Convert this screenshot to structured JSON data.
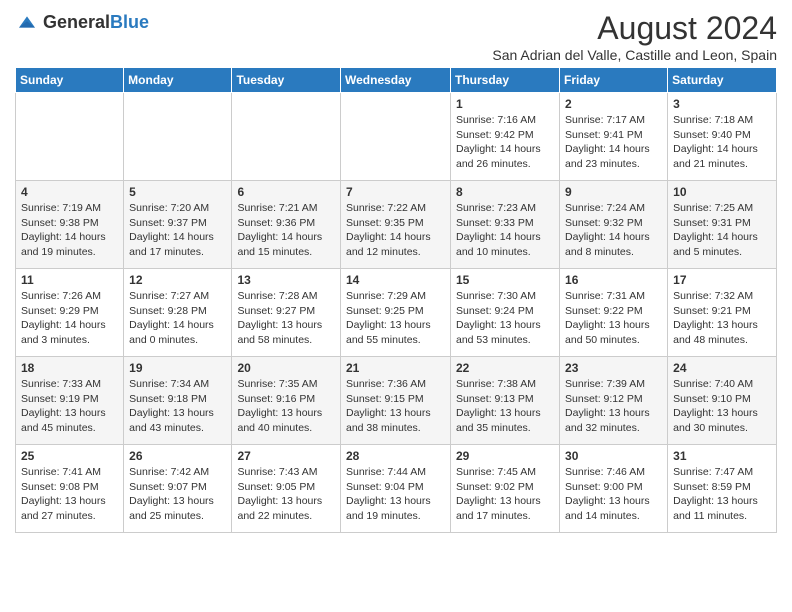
{
  "logo": {
    "text_general": "General",
    "text_blue": "Blue"
  },
  "title": {
    "month_year": "August 2024",
    "location": "San Adrian del Valle, Castille and Leon, Spain"
  },
  "weekdays": [
    "Sunday",
    "Monday",
    "Tuesday",
    "Wednesday",
    "Thursday",
    "Friday",
    "Saturday"
  ],
  "weeks": [
    [
      {
        "day": "",
        "info": ""
      },
      {
        "day": "",
        "info": ""
      },
      {
        "day": "",
        "info": ""
      },
      {
        "day": "",
        "info": ""
      },
      {
        "day": "1",
        "info": "Sunrise: 7:16 AM\nSunset: 9:42 PM\nDaylight: 14 hours and 26 minutes."
      },
      {
        "day": "2",
        "info": "Sunrise: 7:17 AM\nSunset: 9:41 PM\nDaylight: 14 hours and 23 minutes."
      },
      {
        "day": "3",
        "info": "Sunrise: 7:18 AM\nSunset: 9:40 PM\nDaylight: 14 hours and 21 minutes."
      }
    ],
    [
      {
        "day": "4",
        "info": "Sunrise: 7:19 AM\nSunset: 9:38 PM\nDaylight: 14 hours and 19 minutes."
      },
      {
        "day": "5",
        "info": "Sunrise: 7:20 AM\nSunset: 9:37 PM\nDaylight: 14 hours and 17 minutes."
      },
      {
        "day": "6",
        "info": "Sunrise: 7:21 AM\nSunset: 9:36 PM\nDaylight: 14 hours and 15 minutes."
      },
      {
        "day": "7",
        "info": "Sunrise: 7:22 AM\nSunset: 9:35 PM\nDaylight: 14 hours and 12 minutes."
      },
      {
        "day": "8",
        "info": "Sunrise: 7:23 AM\nSunset: 9:33 PM\nDaylight: 14 hours and 10 minutes."
      },
      {
        "day": "9",
        "info": "Sunrise: 7:24 AM\nSunset: 9:32 PM\nDaylight: 14 hours and 8 minutes."
      },
      {
        "day": "10",
        "info": "Sunrise: 7:25 AM\nSunset: 9:31 PM\nDaylight: 14 hours and 5 minutes."
      }
    ],
    [
      {
        "day": "11",
        "info": "Sunrise: 7:26 AM\nSunset: 9:29 PM\nDaylight: 14 hours and 3 minutes."
      },
      {
        "day": "12",
        "info": "Sunrise: 7:27 AM\nSunset: 9:28 PM\nDaylight: 14 hours and 0 minutes."
      },
      {
        "day": "13",
        "info": "Sunrise: 7:28 AM\nSunset: 9:27 PM\nDaylight: 13 hours and 58 minutes."
      },
      {
        "day": "14",
        "info": "Sunrise: 7:29 AM\nSunset: 9:25 PM\nDaylight: 13 hours and 55 minutes."
      },
      {
        "day": "15",
        "info": "Sunrise: 7:30 AM\nSunset: 9:24 PM\nDaylight: 13 hours and 53 minutes."
      },
      {
        "day": "16",
        "info": "Sunrise: 7:31 AM\nSunset: 9:22 PM\nDaylight: 13 hours and 50 minutes."
      },
      {
        "day": "17",
        "info": "Sunrise: 7:32 AM\nSunset: 9:21 PM\nDaylight: 13 hours and 48 minutes."
      }
    ],
    [
      {
        "day": "18",
        "info": "Sunrise: 7:33 AM\nSunset: 9:19 PM\nDaylight: 13 hours and 45 minutes."
      },
      {
        "day": "19",
        "info": "Sunrise: 7:34 AM\nSunset: 9:18 PM\nDaylight: 13 hours and 43 minutes."
      },
      {
        "day": "20",
        "info": "Sunrise: 7:35 AM\nSunset: 9:16 PM\nDaylight: 13 hours and 40 minutes."
      },
      {
        "day": "21",
        "info": "Sunrise: 7:36 AM\nSunset: 9:15 PM\nDaylight: 13 hours and 38 minutes."
      },
      {
        "day": "22",
        "info": "Sunrise: 7:38 AM\nSunset: 9:13 PM\nDaylight: 13 hours and 35 minutes."
      },
      {
        "day": "23",
        "info": "Sunrise: 7:39 AM\nSunset: 9:12 PM\nDaylight: 13 hours and 32 minutes."
      },
      {
        "day": "24",
        "info": "Sunrise: 7:40 AM\nSunset: 9:10 PM\nDaylight: 13 hours and 30 minutes."
      }
    ],
    [
      {
        "day": "25",
        "info": "Sunrise: 7:41 AM\nSunset: 9:08 PM\nDaylight: 13 hours and 27 minutes."
      },
      {
        "day": "26",
        "info": "Sunrise: 7:42 AM\nSunset: 9:07 PM\nDaylight: 13 hours and 25 minutes."
      },
      {
        "day": "27",
        "info": "Sunrise: 7:43 AM\nSunset: 9:05 PM\nDaylight: 13 hours and 22 minutes."
      },
      {
        "day": "28",
        "info": "Sunrise: 7:44 AM\nSunset: 9:04 PM\nDaylight: 13 hours and 19 minutes."
      },
      {
        "day": "29",
        "info": "Sunrise: 7:45 AM\nSunset: 9:02 PM\nDaylight: 13 hours and 17 minutes."
      },
      {
        "day": "30",
        "info": "Sunrise: 7:46 AM\nSunset: 9:00 PM\nDaylight: 13 hours and 14 minutes."
      },
      {
        "day": "31",
        "info": "Sunrise: 7:47 AM\nSunset: 8:59 PM\nDaylight: 13 hours and 11 minutes."
      }
    ]
  ]
}
